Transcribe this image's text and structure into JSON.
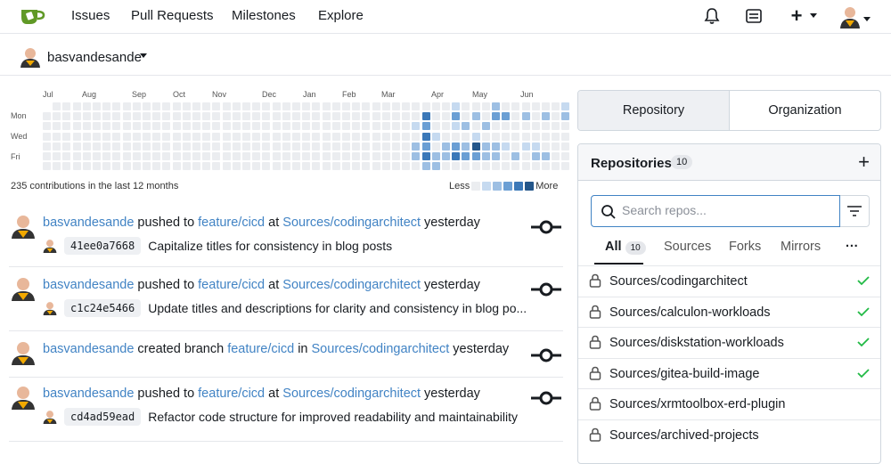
{
  "nav": {
    "items": [
      "Issues",
      "Pull Requests",
      "Milestones",
      "Explore"
    ],
    "icons": [
      "bell-icon",
      "inbox-icon",
      "plus-icon",
      "avatar"
    ],
    "plus_label": "+"
  },
  "userbar": {
    "username": "basvandesande"
  },
  "heatmap": {
    "months": [
      "Jul",
      "Aug",
      "Sep",
      "Oct",
      "Nov",
      "Dec",
      "Jan",
      "Feb",
      "Mar",
      "Apr",
      "May",
      "Jun"
    ],
    "days": [
      "Mon",
      "Wed",
      "Fri"
    ],
    "summary": "235 contributions in the last 12 months",
    "legend_less": "Less",
    "legend_more": "More",
    "colors": [
      "#ebedf0",
      "#c6daf0",
      "#9dbfe3",
      "#6b9fd4",
      "#3b78b8",
      "#24568a"
    ]
  },
  "feed": [
    {
      "user": "basvandesande",
      "action": "pushed to",
      "branch": "feature/cicd",
      "prep": "at",
      "repo": "Sources/codingarchitect",
      "time": "yesterday",
      "sha": "41ee0a7668",
      "message": "Capitalize titles for consistency in blog posts"
    },
    {
      "user": "basvandesande",
      "action": "pushed to",
      "branch": "feature/cicd",
      "prep": "at",
      "repo": "Sources/codingarchitect",
      "time": "yesterday",
      "sha": "c1c24e5466",
      "message": "Update titles and descriptions for clarity and consistency in blog po..."
    },
    {
      "user": "basvandesande",
      "action": "created branch",
      "branch": "feature/cicd",
      "prep": "in",
      "repo": "Sources/codingarchitect",
      "time": "yesterday",
      "sha": "",
      "message": ""
    },
    {
      "user": "basvandesande",
      "action": "pushed to",
      "branch": "feature/cicd",
      "prep": "at",
      "repo": "Sources/codingarchitect",
      "time": "yesterday",
      "sha": "cd4ad59ead",
      "message": "Refactor code structure for improved readability and maintainability"
    }
  ],
  "panel": {
    "tab_repository": "Repository",
    "tab_organization": "Organization",
    "title": "Repositories",
    "count": "10",
    "plus": "+",
    "search_placeholder": "Search repos...",
    "subtabs": [
      "All",
      "Sources",
      "Forks",
      "Mirrors"
    ],
    "all_count": "10",
    "more": "···",
    "repos": [
      {
        "name": "Sources/codingarchitect",
        "status": "success"
      },
      {
        "name": "Sources/calculon-workloads",
        "status": "success"
      },
      {
        "name": "Sources/diskstation-workloads",
        "status": "success"
      },
      {
        "name": "Sources/gitea-build-image",
        "status": "success"
      },
      {
        "name": "Sources/xrmtoolbox-erd-plugin",
        "status": ""
      },
      {
        "name": "Sources/archived-projects",
        "status": ""
      }
    ],
    "success_color": "#21ba45"
  }
}
